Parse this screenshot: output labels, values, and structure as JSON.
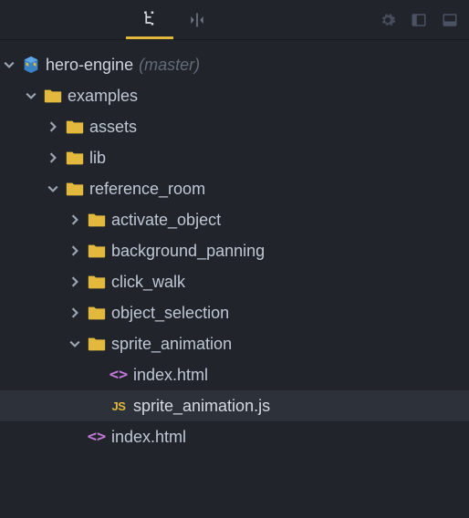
{
  "project": {
    "name": "hero-engine",
    "branch": "(master)"
  },
  "tree": {
    "examples": {
      "label": "examples",
      "assets": "assets",
      "lib": "lib",
      "reference_room": {
        "label": "reference_room",
        "activate_object": "activate_object",
        "background_panning": "background_panning",
        "click_walk": "click_walk",
        "object_selection": "object_selection",
        "sprite_animation": {
          "label": "sprite_animation",
          "index_html": "index.html",
          "sprite_animation_js": "sprite_animation.js"
        },
        "index_html": "index.html"
      }
    }
  },
  "icons": {
    "tree_tab": "tree-structure-icon",
    "focus_tab": "focus-selection-icon",
    "gear": "gear-icon",
    "panel_left": "toggle-left-panel-icon",
    "panel_bottom": "toggle-bottom-panel-icon"
  }
}
